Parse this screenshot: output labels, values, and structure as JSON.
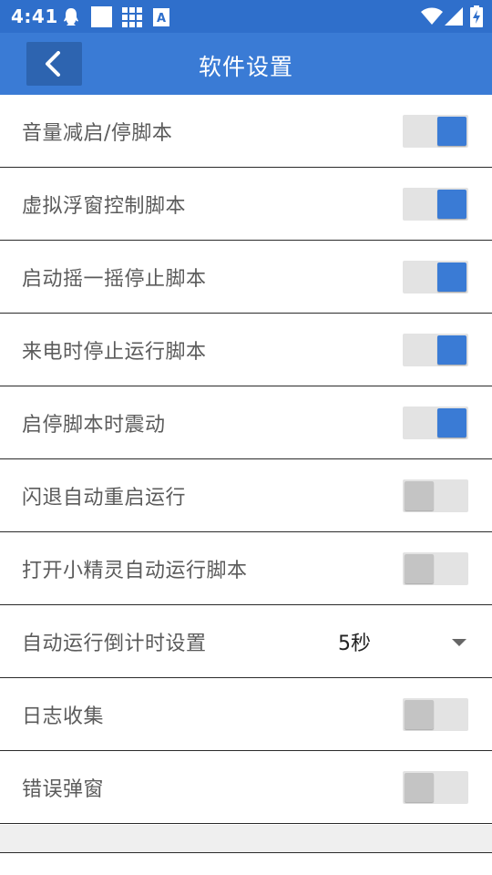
{
  "status_bar": {
    "time": "4:41",
    "left_icons": [
      "qq-penguin-icon",
      "white-square-icon",
      "grid-apps-icon",
      "text-a-icon"
    ],
    "right_icons": [
      "wifi-icon",
      "cell-signal-icon",
      "battery-charging-icon"
    ]
  },
  "toolbar": {
    "title": "软件设置",
    "back_icon": "chevron-left-icon"
  },
  "settings": [
    {
      "label": "音量减启/停脚本",
      "type": "switch",
      "on": true
    },
    {
      "label": "虚拟浮窗控制脚本",
      "type": "switch",
      "on": true
    },
    {
      "label": "启动摇一摇停止脚本",
      "type": "switch",
      "on": true
    },
    {
      "label": "来电时停止运行脚本",
      "type": "switch",
      "on": true
    },
    {
      "label": "启停脚本时震动",
      "type": "switch",
      "on": true
    },
    {
      "label": "闪退自动重启运行",
      "type": "switch",
      "on": false
    },
    {
      "label": "打开小精灵自动运行脚本",
      "type": "switch",
      "on": false
    },
    {
      "label": "自动运行倒计时设置",
      "type": "select",
      "value": "5秒"
    },
    {
      "label": "日志收集",
      "type": "switch",
      "on": false
    },
    {
      "label": "错误弹窗",
      "type": "switch",
      "on": false
    }
  ],
  "colors": {
    "status_bar": "#2f6fcb",
    "toolbar": "#3a7bd5",
    "switch_on": "#3a7bd5",
    "switch_off_thumb": "#c4c4c4",
    "switch_track": "#e3e3e3"
  }
}
